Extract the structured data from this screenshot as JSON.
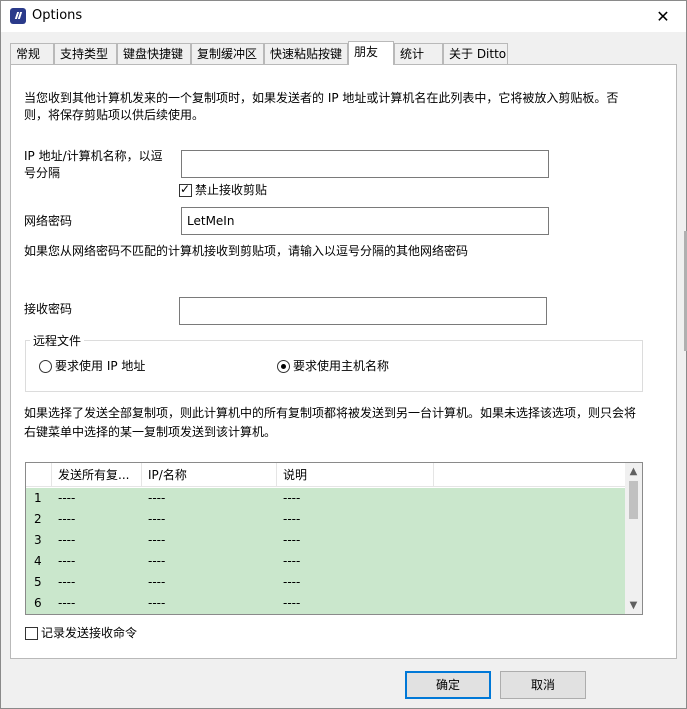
{
  "window": {
    "title": "Options",
    "close_glyph": "✕"
  },
  "tabs": [
    {
      "label": "常规"
    },
    {
      "label": "支持类型"
    },
    {
      "label": "键盘快捷键"
    },
    {
      "label": "复制缓冲区"
    },
    {
      "label": "快速粘贴按键"
    },
    {
      "label": "朋友"
    },
    {
      "label": "统计"
    },
    {
      "label": "关于 Ditto"
    }
  ],
  "active_tab": "朋友",
  "friends": {
    "intro_line1": "当您收到其他计算机发来的一个复制项时，如果发送者的 IP 地址或计算机名在此列表中，它将被放入剪贴板。否",
    "intro_line2": "则，将保存剪贴项以供后续使用。",
    "ip_label_line1": "IP 地址/计算机名称，以逗",
    "ip_label_line2": "号分隔",
    "ip_value": "",
    "disable_receive_label": "禁止接收剪贴",
    "disable_receive_checked": true,
    "network_password_label": "网络密码",
    "network_password_value": "LetMeIn",
    "other_passwords_note": "如果您从网络密码不匹配的计算机接收到剪贴项，请输入以逗号分隔的其他网络密码",
    "receive_password_label": "接收密码",
    "receive_password_value": "",
    "remote_files": {
      "legend": "远程文件",
      "option_ip": "要求使用 IP 地址",
      "option_hostname": "要求使用主机名称",
      "selected": "hostname"
    },
    "send_all_note_line1": "如果选择了发送全部复制项，则此计算机中的所有复制项都将被发送到另一台计算机。如果未选择该选项，则只会将",
    "send_all_note_line2": "右键菜单中选择的某一复制项发送到该计算机。",
    "table": {
      "columns": [
        "",
        "发送所有复...",
        "IP/名称",
        "说明"
      ],
      "rows": [
        {
          "num": "1",
          "send_all": "----",
          "ip": "----",
          "desc": "----"
        },
        {
          "num": "2",
          "send_all": "----",
          "ip": "----",
          "desc": "----"
        },
        {
          "num": "3",
          "send_all": "----",
          "ip": "----",
          "desc": "----"
        },
        {
          "num": "4",
          "send_all": "----",
          "ip": "----",
          "desc": "----"
        },
        {
          "num": "5",
          "send_all": "----",
          "ip": "----",
          "desc": "----"
        },
        {
          "num": "6",
          "send_all": "----",
          "ip": "----",
          "desc": "----"
        }
      ]
    },
    "log_label": "记录发送接收命令",
    "log_checked": false
  },
  "buttons": {
    "ok": "确定",
    "cancel": "取消"
  },
  "colors": {
    "row_bg": "#cae7cc",
    "accent": "#0078d7"
  }
}
